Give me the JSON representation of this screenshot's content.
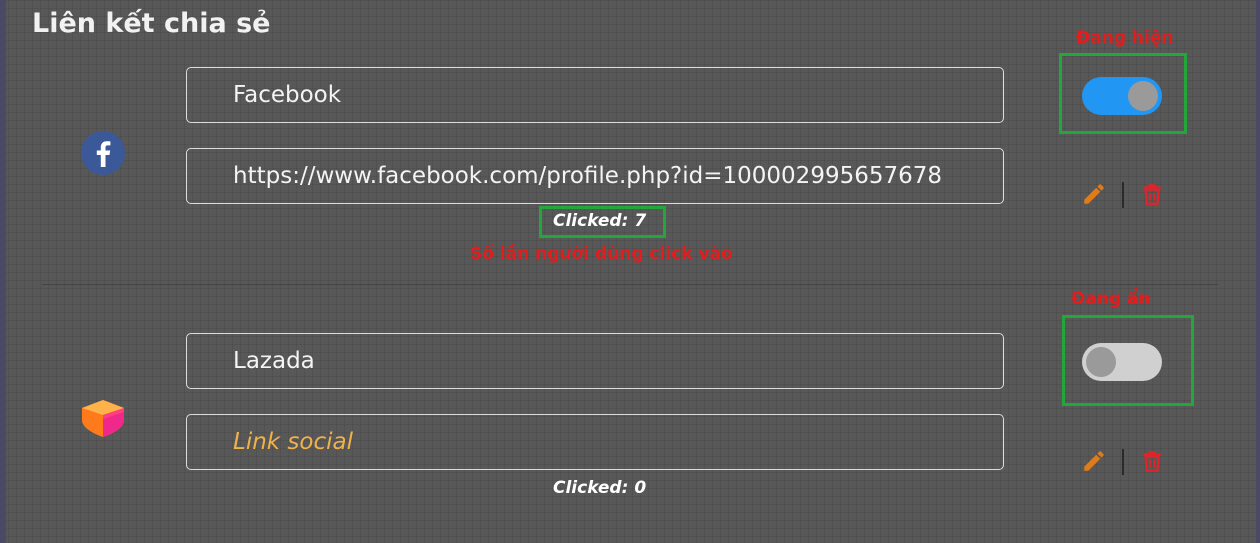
{
  "header": {
    "title": "Liên kết chia sẻ"
  },
  "items": [
    {
      "name": "Facebook",
      "link": "https://www.facebook.com/profile.php?id=100002995657678",
      "link_placeholder": "",
      "clicked": "Clicked: 7",
      "status_label": "Đang hiện",
      "toggle_on": true,
      "clicks_note": "Số lần người dùng click vào",
      "icon": "facebook-icon"
    },
    {
      "name": "Lazada",
      "link": "",
      "link_placeholder": "Link social",
      "clicked": "Clicked: 0",
      "status_label": "Đang ẩn",
      "toggle_on": false,
      "icon": "lazada-icon"
    }
  ],
  "colors": {
    "background": "#585858",
    "toggle_on": "#2196f3",
    "toggle_off": "#d0d0d0",
    "annotation": "#e11d1d",
    "highlight_box": "#22a83a",
    "edit_icon": "#e07b1a",
    "delete_icon": "#e0242a",
    "placeholder": "#f0b24a"
  }
}
